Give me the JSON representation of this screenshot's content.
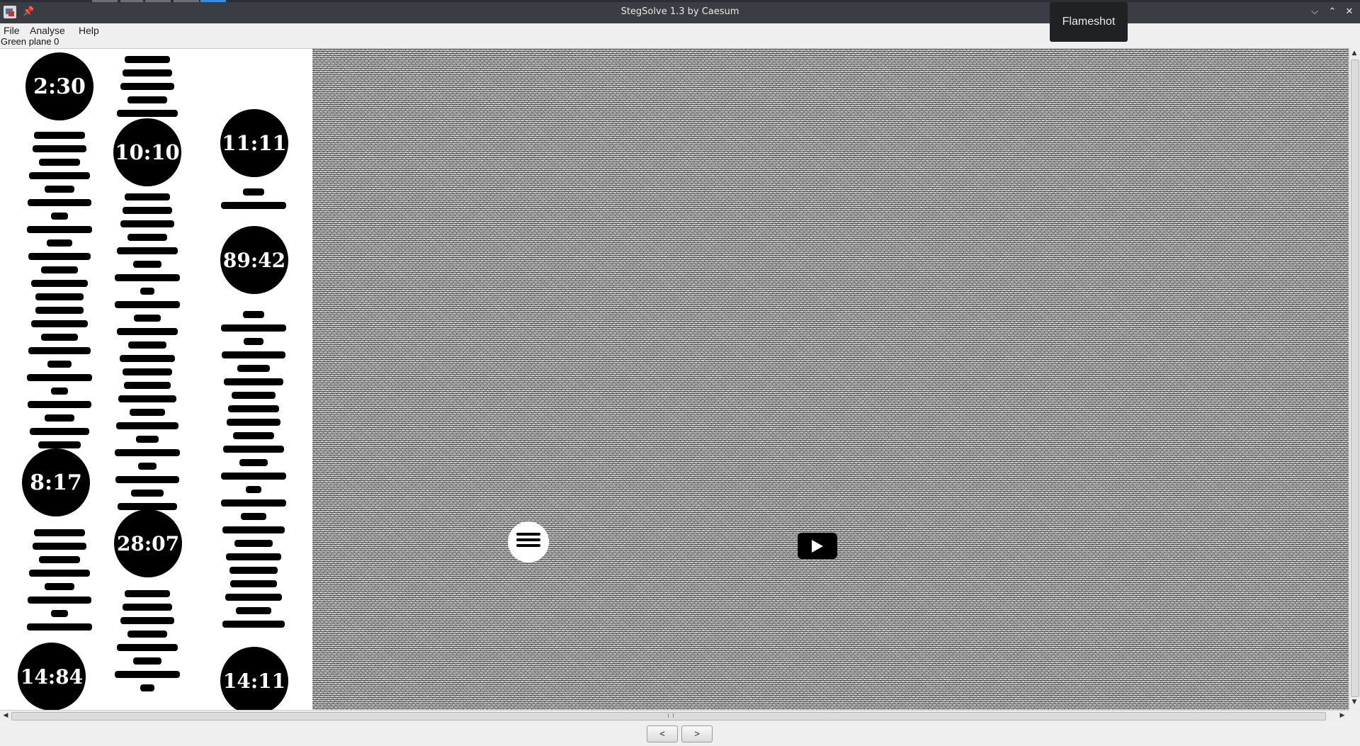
{
  "window": {
    "title": "StegSolve 1.3 by Caesum",
    "minimize": "⌵",
    "maximize": "⌃",
    "close": "✕"
  },
  "menu": [
    "File",
    "Analyse",
    "Help"
  ],
  "plane_label": "Green plane 0",
  "image": {
    "clock_labels": [
      "2:30",
      "10:10",
      "11:11",
      "89:42",
      "8:17",
      "28:07",
      "14:84",
      "14:11"
    ]
  },
  "nav": {
    "prev_label": "<",
    "next_label": ">"
  },
  "tooltip": {
    "text": "Flameshot"
  },
  "scroll": {
    "up": "▲",
    "down": "▼",
    "left": "◀",
    "right": "▶"
  }
}
